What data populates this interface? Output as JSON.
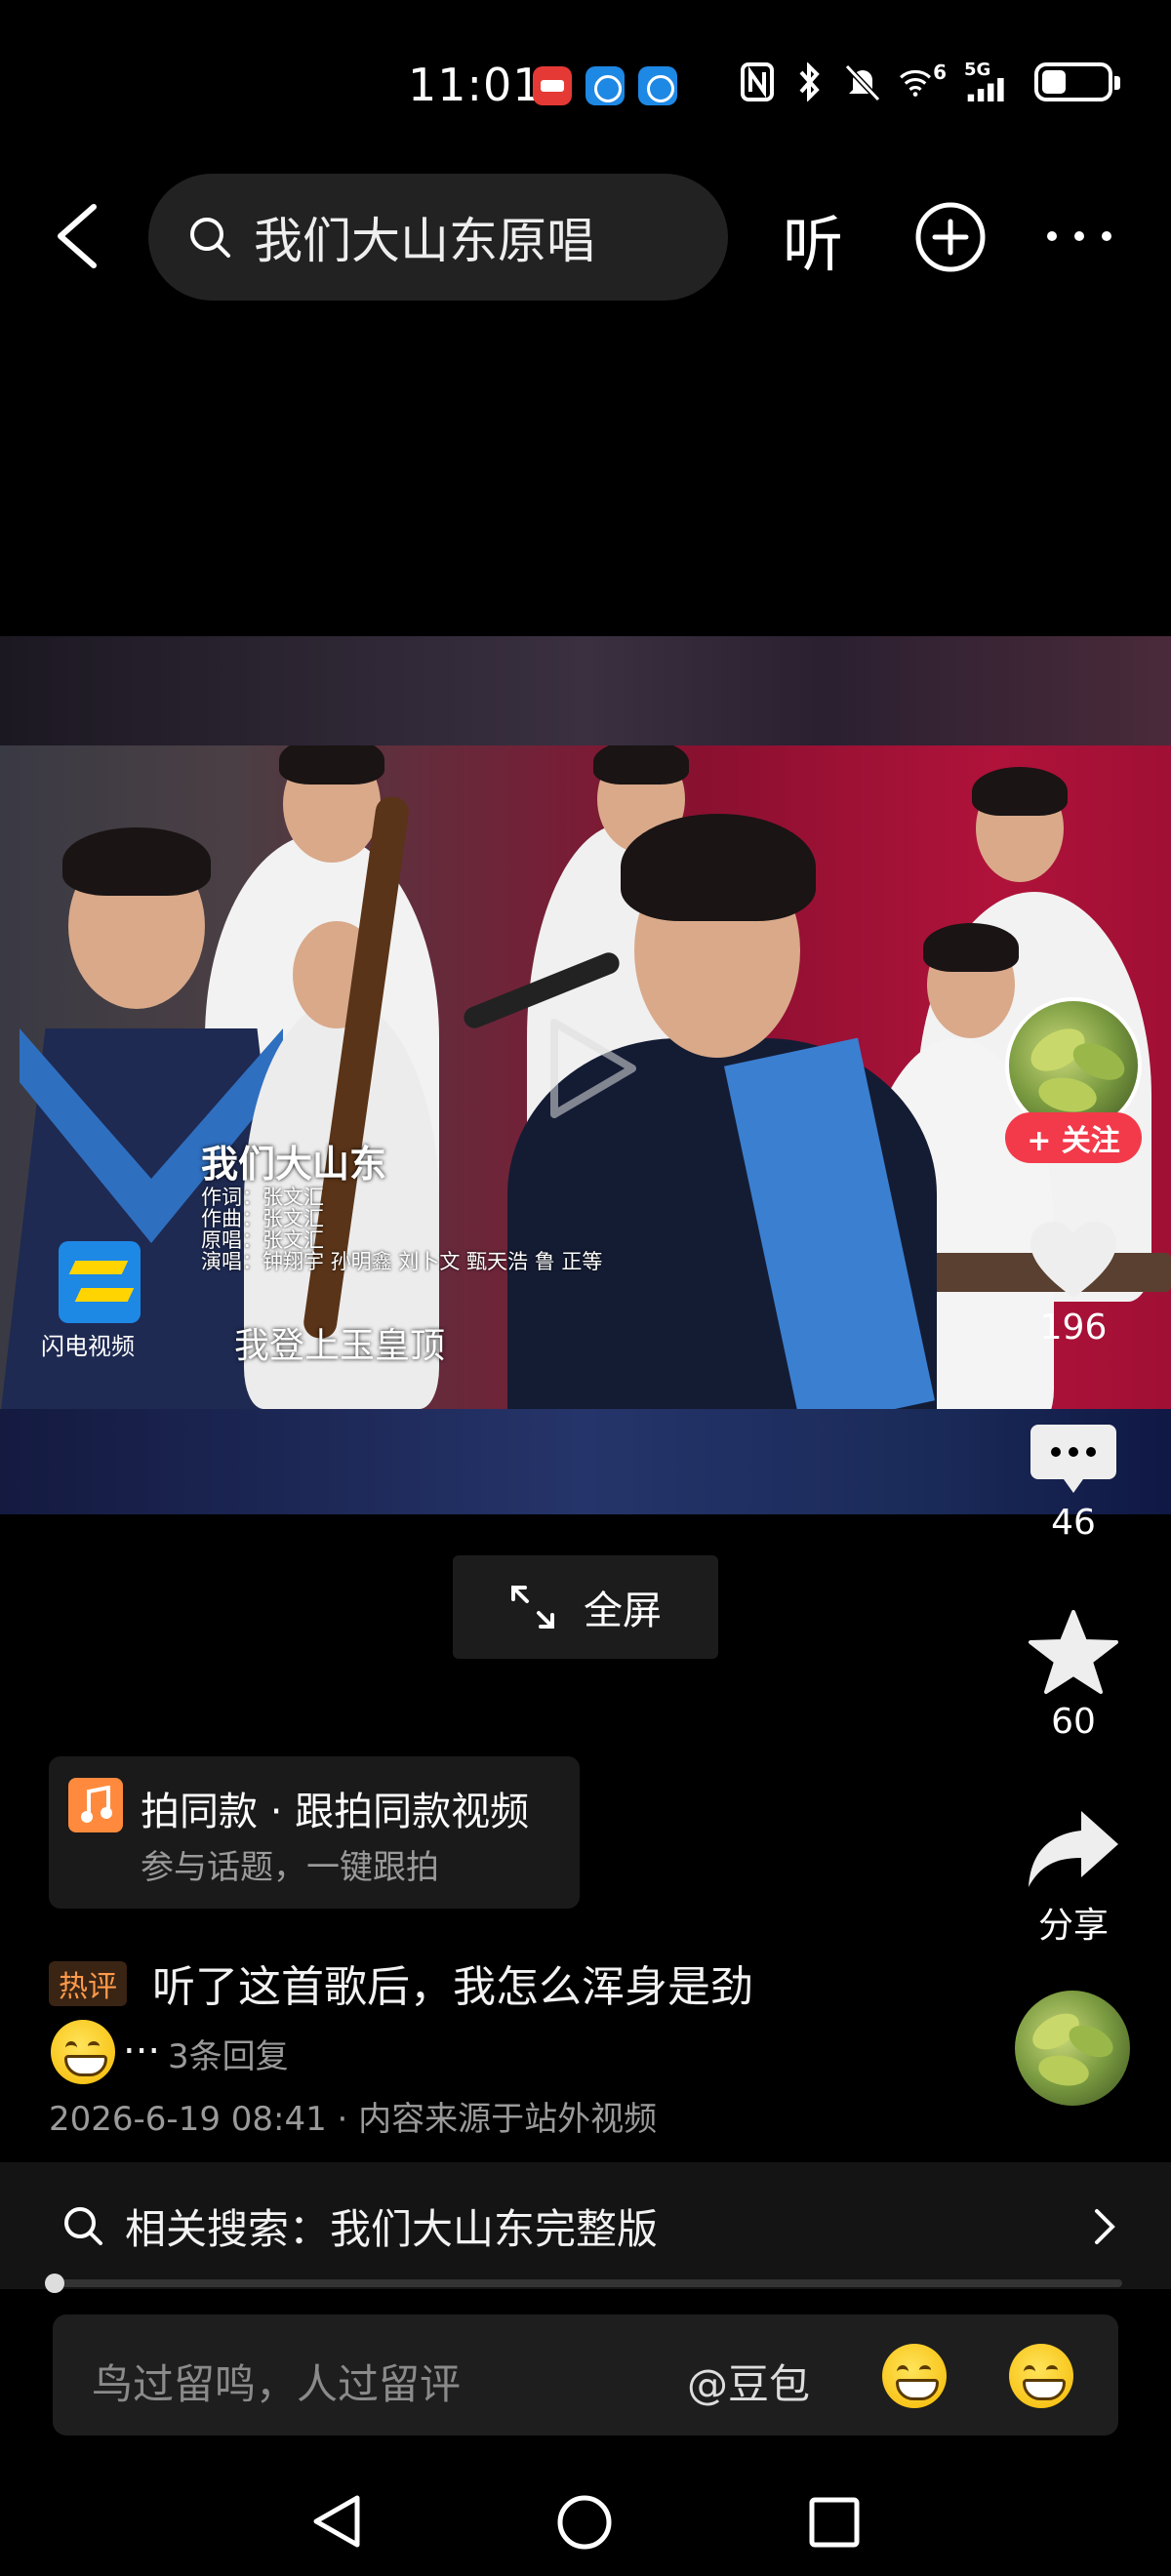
{
  "status_bar": {
    "time": "11:01",
    "network": "5G",
    "wifi_badge": "6",
    "battery_level": 0.38,
    "icons": [
      "xiaohongshu-notif-icon",
      "browser-notif-icon",
      "browser-notif-icon",
      "nfc-icon",
      "bluetooth-icon",
      "mute-icon",
      "wifi-icon",
      "signal-icon",
      "battery-icon"
    ]
  },
  "header": {
    "search_query": "我们大山东原唱",
    "listen_label": "听"
  },
  "video": {
    "title": "我们大山东",
    "credits": [
      "作词：张文汇",
      "作曲：张文汇",
      "原唱：张文汇",
      "演唱：钟翔宇  孙明鑫  刘卜文  甄天浩  鲁  正等"
    ],
    "subtitle": "我登上玉皇顶",
    "logo_label": "闪电视频"
  },
  "right_rail": {
    "follow_label": "+ 关注",
    "likes": "196",
    "comments": "46",
    "favorites": "60",
    "share_label": "分享"
  },
  "fullscreen_label": "全屏",
  "same_style": {
    "title": "拍同款 · 跟拍同款视频",
    "subtitle": "参与话题，一键跟拍"
  },
  "hot_comment": {
    "badge": "热评",
    "text": "听了这首歌后，我怎么浑身是劲",
    "ellipsis": "...",
    "replies": "3条回复"
  },
  "meta": "2026-6-19 08:41 · 内容来源于站外视频",
  "related_search": "相关搜索：我们大山东完整版",
  "progress": 0.0,
  "comment_input": {
    "placeholder": "鸟过留鸣，人过留评",
    "mention": "@豆包"
  },
  "colors": {
    "background": "#000000",
    "follow": "#f23a4a",
    "hot_badge": "#ff9a4a"
  }
}
